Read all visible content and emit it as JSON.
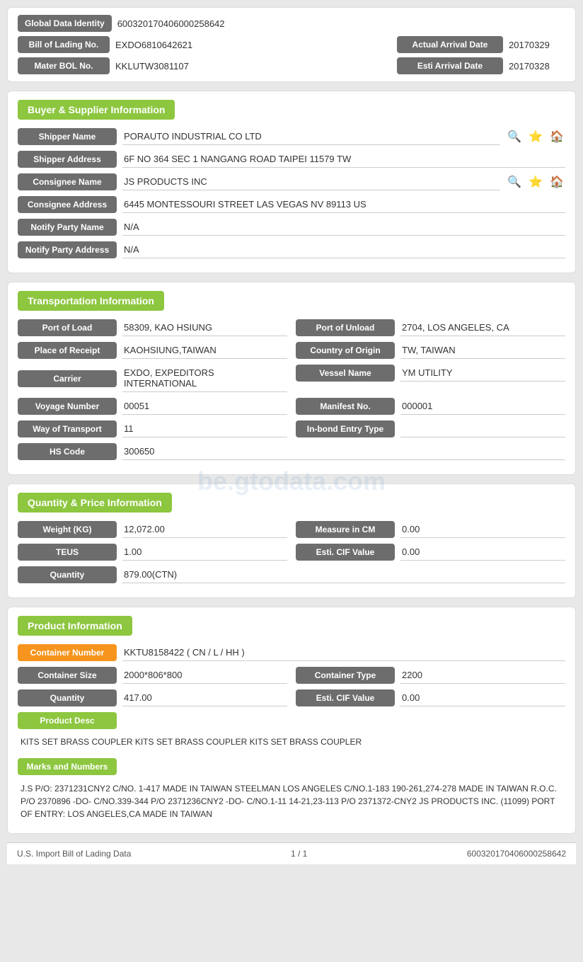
{
  "global_id": {
    "label": "Global Data Identity",
    "value": "600320170406000258642"
  },
  "bol": {
    "label": "Bill of Lading No.",
    "value": "EXDO6810642621",
    "actual_arrival_label": "Actual Arrival Date",
    "actual_arrival_value": "20170329"
  },
  "mater_bol": {
    "label": "Mater BOL No.",
    "value": "KKLUTW3081107",
    "esti_arrival_label": "Esti Arrival Date",
    "esti_arrival_value": "20170328"
  },
  "buyer_supplier": {
    "header": "Buyer & Supplier Information",
    "shipper_name_label": "Shipper Name",
    "shipper_name_value": "PORAUTO INDUSTRIAL CO LTD",
    "shipper_address_label": "Shipper Address",
    "shipper_address_value": "6F NO 364 SEC 1 NANGANG ROAD TAIPEI 11579 TW",
    "consignee_name_label": "Consignee Name",
    "consignee_name_value": "JS PRODUCTS INC",
    "consignee_address_label": "Consignee Address",
    "consignee_address_value": "6445 MONTESSOURI STREET LAS VEGAS NV 89113 US",
    "notify_party_name_label": "Notify Party Name",
    "notify_party_name_value": "N/A",
    "notify_party_address_label": "Notify Party Address",
    "notify_party_address_value": "N/A"
  },
  "transportation": {
    "header": "Transportation Information",
    "port_load_label": "Port of Load",
    "port_load_value": "58309, KAO HSIUNG",
    "port_unload_label": "Port of Unload",
    "port_unload_value": "2704, LOS ANGELES, CA",
    "place_receipt_label": "Place of Receipt",
    "place_receipt_value": "KAOHSIUNG,TAIWAN",
    "country_origin_label": "Country of Origin",
    "country_origin_value": "TW, TAIWAN",
    "carrier_label": "Carrier",
    "carrier_value": "EXDO, EXPEDITORS INTERNATIONAL",
    "vessel_name_label": "Vessel Name",
    "vessel_name_value": "YM UTILITY",
    "voyage_number_label": "Voyage Number",
    "voyage_number_value": "00051",
    "manifest_no_label": "Manifest No.",
    "manifest_no_value": "000001",
    "way_transport_label": "Way of Transport",
    "way_transport_value": "11",
    "inbond_entry_label": "In-bond Entry Type",
    "inbond_entry_value": "",
    "hs_code_label": "HS Code",
    "hs_code_value": "300650"
  },
  "quantity_price": {
    "header": "Quantity & Price Information",
    "weight_label": "Weight (KG)",
    "weight_value": "12,072.00",
    "measure_label": "Measure in CM",
    "measure_value": "0.00",
    "teus_label": "TEUS",
    "teus_value": "1.00",
    "esti_cif_label": "Esti. CIF Value",
    "esti_cif_value": "0.00",
    "quantity_label": "Quantity",
    "quantity_value": "879.00(CTN)"
  },
  "product_info": {
    "header": "Product Information",
    "container_number_label": "Container Number",
    "container_number_value": "KKTU8158422 ( CN / L / HH )",
    "container_size_label": "Container Size",
    "container_size_value": "2000*806*800",
    "container_type_label": "Container Type",
    "container_type_value": "2200",
    "quantity_label": "Quantity",
    "quantity_value": "417.00",
    "esti_cif_label": "Esti. CIF Value",
    "esti_cif_value": "0.00",
    "product_desc_label": "Product Desc",
    "product_desc_value": "KITS SET BRASS COUPLER KITS SET BRASS COUPLER KITS SET BRASS COUPLER",
    "marks_label": "Marks and Numbers",
    "marks_value": "J.S P/O: 2371231CNY2 C/NO. 1-417 MADE IN TAIWAN STEELMAN LOS ANGELES C/NO.1-183 190-261,274-278 MADE IN TAIWAN R.O.C. P/O 2370896 -DO- C/NO.339-344 P/O 2371236CNY2 -DO- C/NO.1-11 14-21,23-113 P/O 2371372-CNY2 JS PRODUCTS INC. (11099) PORT OF ENTRY: LOS ANGELES,CA MADE IN TAIWAN"
  },
  "footer": {
    "left": "U.S. Import Bill of Lading Data",
    "center": "1 / 1",
    "right": "600320170406000258642"
  },
  "watermark": "be.gtodata.com",
  "icons": {
    "search": "🔍",
    "star": "⭐",
    "home": "🏠"
  }
}
